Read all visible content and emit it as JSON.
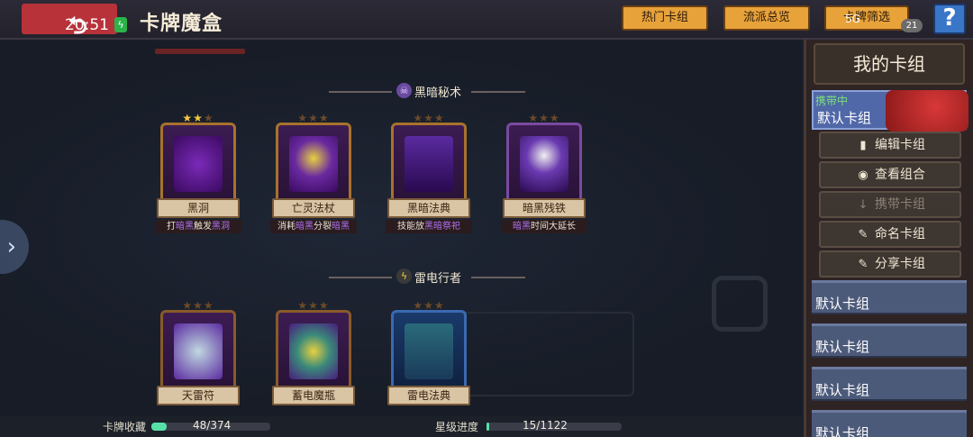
{
  "header": {
    "back_icon": "back-arrow-icon",
    "time": "20:51",
    "title": "卡牌魔盒",
    "buttons": [
      "热门卡组",
      "流派总览",
      "卡牌筛选"
    ],
    "speed": "5G",
    "badge": "21",
    "help": "?"
  },
  "sections": [
    {
      "title": "黑暗秘术",
      "cards": [
        {
          "name": "黑洞",
          "desc_pre": "打",
          "desc_hl": "暗黑",
          "desc_mid": "触发",
          "desc_hl2": "黑洞",
          "desc_post": "",
          "stars_lit": 2,
          "stars_total": 3
        },
        {
          "name": "亡灵法杖",
          "desc_pre": "消耗",
          "desc_hl": "暗黑",
          "desc_mid": "分裂",
          "desc_hl2": "暗黑",
          "desc_post": "",
          "stars_lit": 0,
          "stars_total": 3
        },
        {
          "name": "黑暗法典",
          "desc_pre": "技能放",
          "desc_hl": "黑暗祭祀",
          "desc_mid": "",
          "desc_hl2": "",
          "desc_post": "",
          "stars_lit": 0,
          "stars_total": 3
        },
        {
          "name": "暗黑残铁",
          "desc_pre": "",
          "desc_hl": "暗黑",
          "desc_mid": "时间大延长",
          "desc_hl2": "",
          "desc_post": "",
          "stars_lit": 0,
          "stars_total": 3
        }
      ]
    },
    {
      "title": "雷电行者",
      "cards": [
        {
          "name": "天雷符",
          "stars_lit": 0,
          "stars_total": 3
        },
        {
          "name": "蓄电魔瓶",
          "stars_lit": 0,
          "stars_total": 3
        },
        {
          "name": "雷电法典",
          "stars_lit": 0,
          "stars_total": 3
        }
      ]
    }
  ],
  "bottom": {
    "collection_label": "卡牌收藏",
    "collection_value": "48/374",
    "collection_fraction": 0.128,
    "star_label": "星级进度",
    "star_value": "15/1122",
    "star_fraction": 0.013
  },
  "right_panel": {
    "title": "我的卡组",
    "carry_label": "携带中",
    "active_deck": "默认卡组",
    "actions": [
      {
        "label": "编辑卡组",
        "icon": "card-icon",
        "glyph": "▮",
        "enabled": true
      },
      {
        "label": "查看组合",
        "icon": "eye-icon",
        "glyph": "◉",
        "enabled": true
      },
      {
        "label": "携带卡组",
        "icon": "download-icon",
        "glyph": "↓",
        "enabled": false
      },
      {
        "label": "命名卡组",
        "icon": "pencil-icon",
        "glyph": "✎",
        "enabled": true
      },
      {
        "label": "分享卡组",
        "icon": "pencil-icon",
        "glyph": "✎",
        "enabled": true
      }
    ],
    "decks": [
      "默认卡组",
      "默认卡组",
      "默认卡组",
      "默认卡组"
    ]
  },
  "colors": {
    "accent_gold": "#e8a23a",
    "dark_purple": "#b070f0",
    "active_green": "#7be07b",
    "progress_teal": "#57e0a8"
  }
}
